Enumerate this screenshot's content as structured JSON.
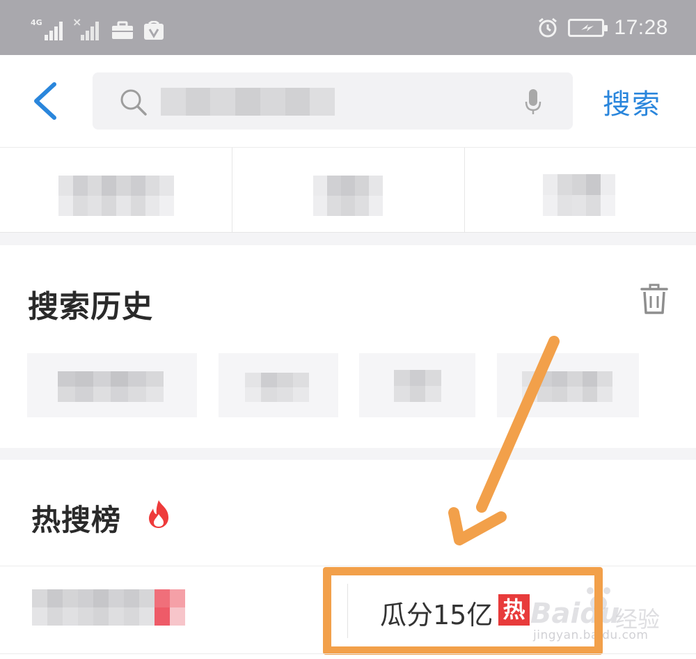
{
  "status_bar": {
    "network": "4G",
    "time": "17:28"
  },
  "search": {
    "back_label": "‹",
    "query_placeholder": "",
    "button_label": "搜索"
  },
  "history": {
    "title": "搜索历史",
    "icon": "trash-icon"
  },
  "hot": {
    "title": "热搜榜",
    "icon": "flame-icon",
    "items": [
      {
        "text": "瓜分15亿",
        "badge": "热"
      }
    ]
  },
  "watermark": {
    "brand": "Baidu",
    "brand_cn": "经验",
    "url": "jingyan.baidu.com"
  },
  "colors": {
    "accent": "#2a86dc",
    "hot_badge": "#e83b3b",
    "annotation": "#f2a04a",
    "status_bar": "#a9a8ad"
  }
}
